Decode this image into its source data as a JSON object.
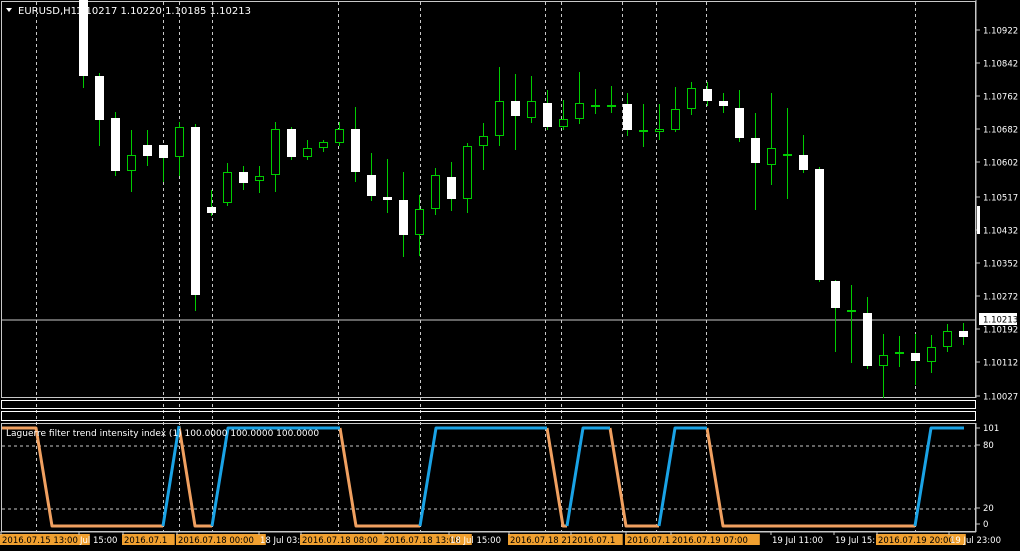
{
  "main_chart": {
    "symbol_label": "EURUSD,H1",
    "ohlc_label": "1.10217 1.10220 1.10185 1.10213",
    "current_price_label": "1.10213",
    "price_ticks": [
      "1.10922",
      "1.10842",
      "1.10762",
      "1.10682",
      "1.10602",
      "1.10517",
      "1.10432",
      "1.10352",
      "1.10272",
      "1.10192",
      "1.10112",
      "1.10027"
    ]
  },
  "indicator": {
    "label": "Laguerre filter trend intensity index (1) 100.0000 100.0000 100.0000",
    "level_ticks": [
      "101",
      "80",
      "20",
      "0"
    ]
  },
  "time_axis": {
    "labels": [
      {
        "text": "2016.07.15 13:00",
        "hl": true
      },
      {
        "text": "Jul 15:00",
        "hl": false
      },
      {
        "text": "2016.07.1",
        "hl": true
      },
      {
        "text": "2016.07.18 00:00",
        "hl": true
      },
      {
        "text": "18 Jul 03:",
        "hl": false
      },
      {
        "text": "2016.07.18 08:00",
        "hl": true
      },
      {
        "text": "2016.07.18 13:00",
        "hl": true
      },
      {
        "text": "18 Jul 15:00",
        "hl": false
      },
      {
        "text": "2016.07.18 21",
        "hl": true
      },
      {
        "text": "2016.07.1",
        "hl": true
      },
      {
        "text": "2016.07.1",
        "hl": true
      },
      {
        "text": "2016.07.19 07:00",
        "hl": true
      },
      {
        "text": "19 Jul 11:00",
        "hl": false
      },
      {
        "text": "19 Jul 15:",
        "hl": false
      },
      {
        "text": "2016.07.19 20:00",
        "hl": true
      },
      {
        "text": "19 Jul 23:00",
        "hl": false
      }
    ]
  },
  "colors": {
    "background": "#000000",
    "bull_wick": "#00cc00",
    "bear_body": "#ffffff",
    "grid": "#c8c8c8",
    "indicator_up": "#1aa3e6",
    "indicator_down": "#f0a060",
    "label_highlight": "#f0a030"
  }
}
